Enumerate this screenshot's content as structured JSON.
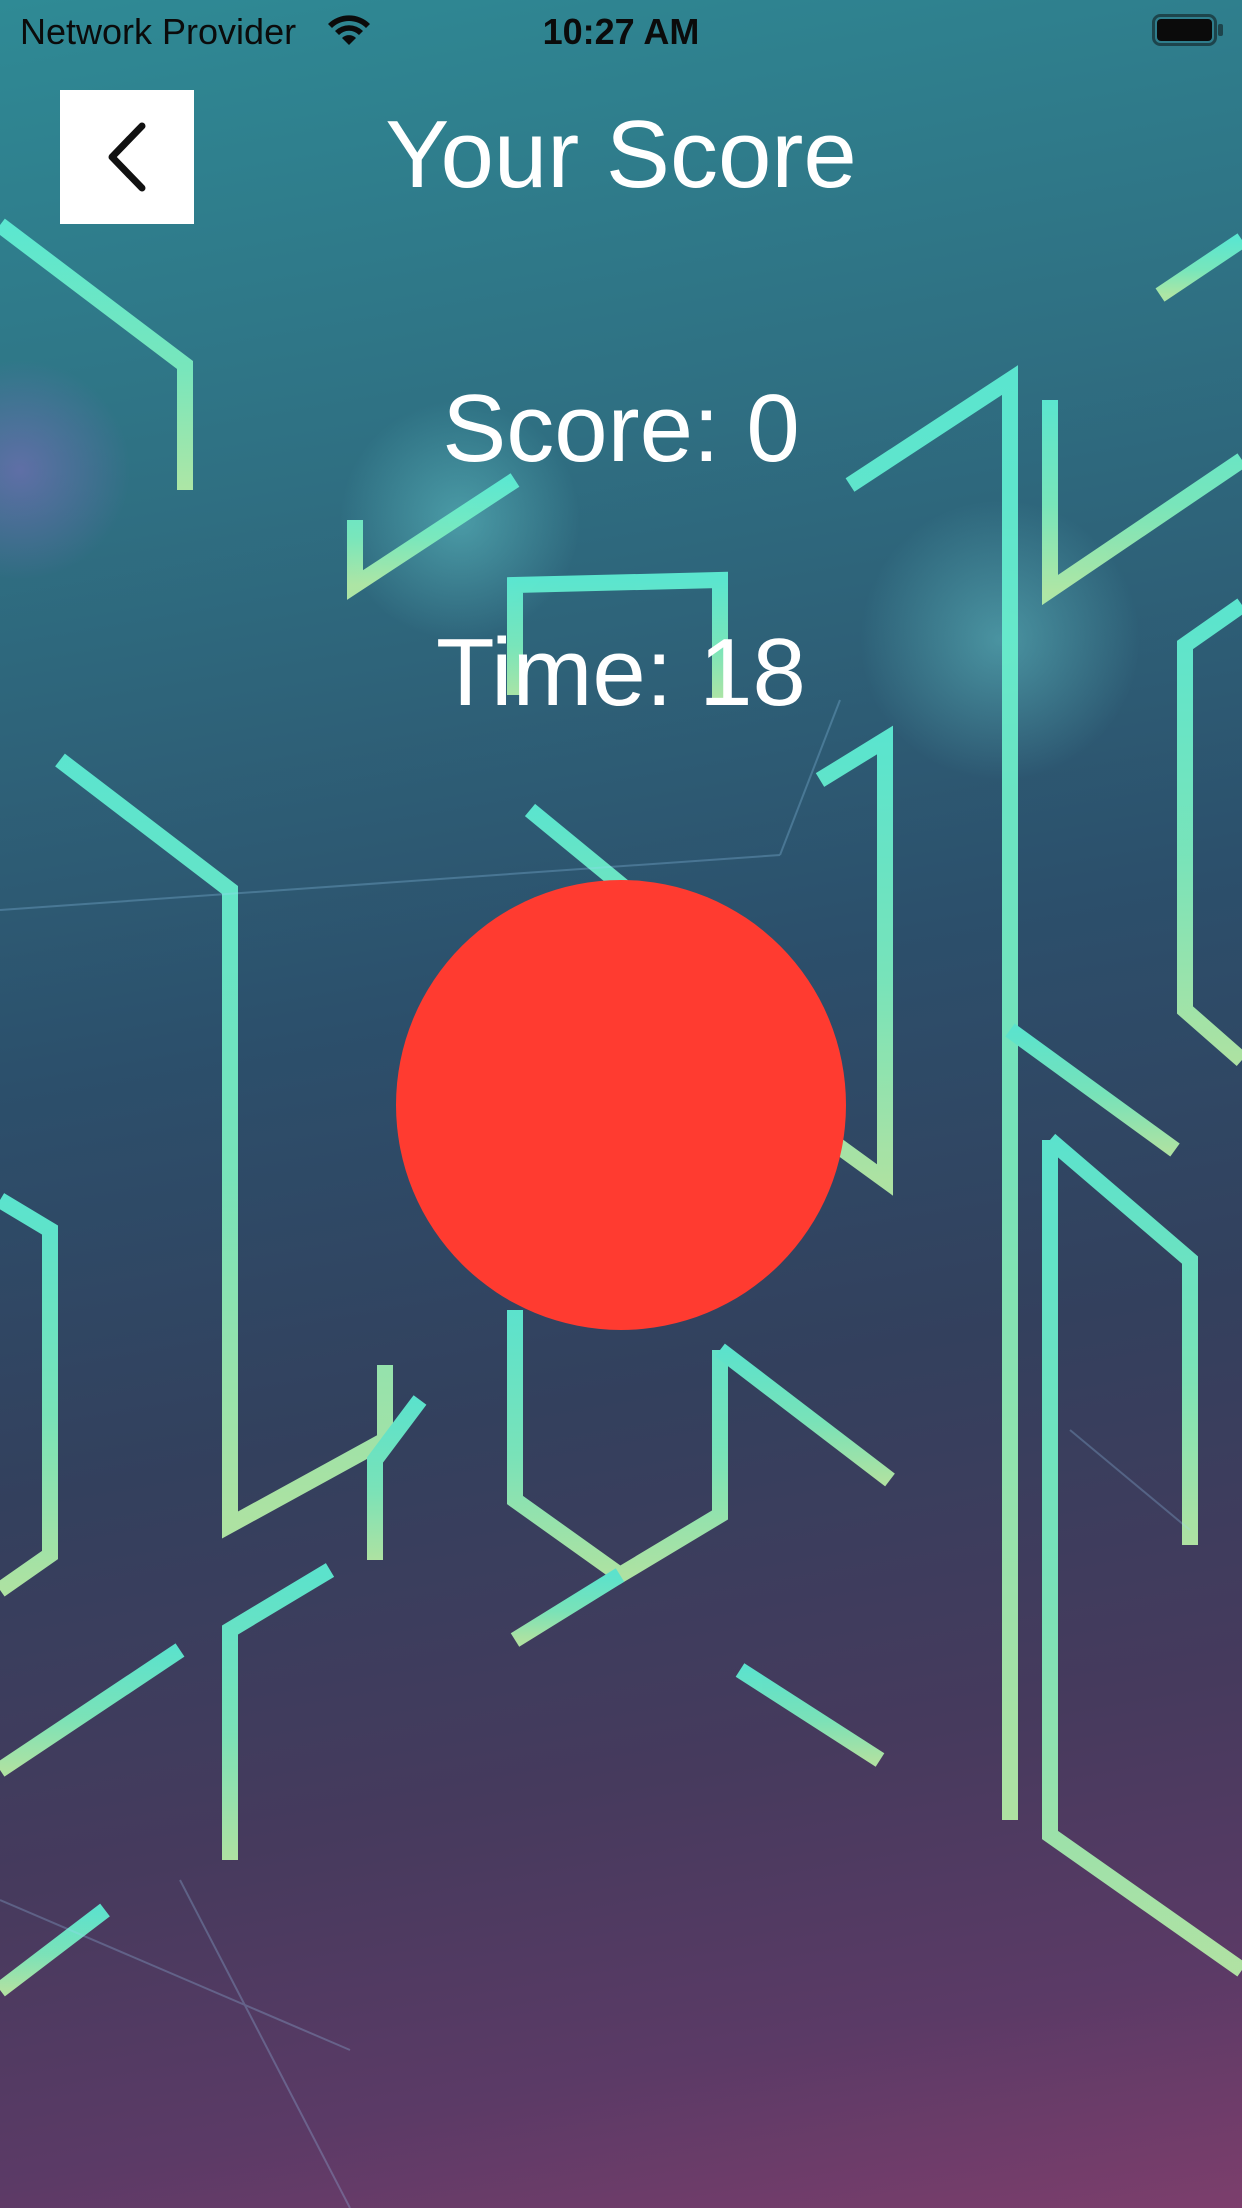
{
  "status_bar": {
    "carrier": "Network Provider",
    "time": "10:27 AM",
    "wifi_icon": "wifi-icon",
    "battery_icon": "battery-full-icon"
  },
  "header": {
    "title": "Your Score",
    "back_icon": "chevron-left-icon"
  },
  "game": {
    "score_text": "Score: 0",
    "time_text": "Time: 18",
    "target_color": "#ff3b30"
  },
  "colors": {
    "line_accent": "#6ee8c8",
    "text": "#ffffff"
  }
}
